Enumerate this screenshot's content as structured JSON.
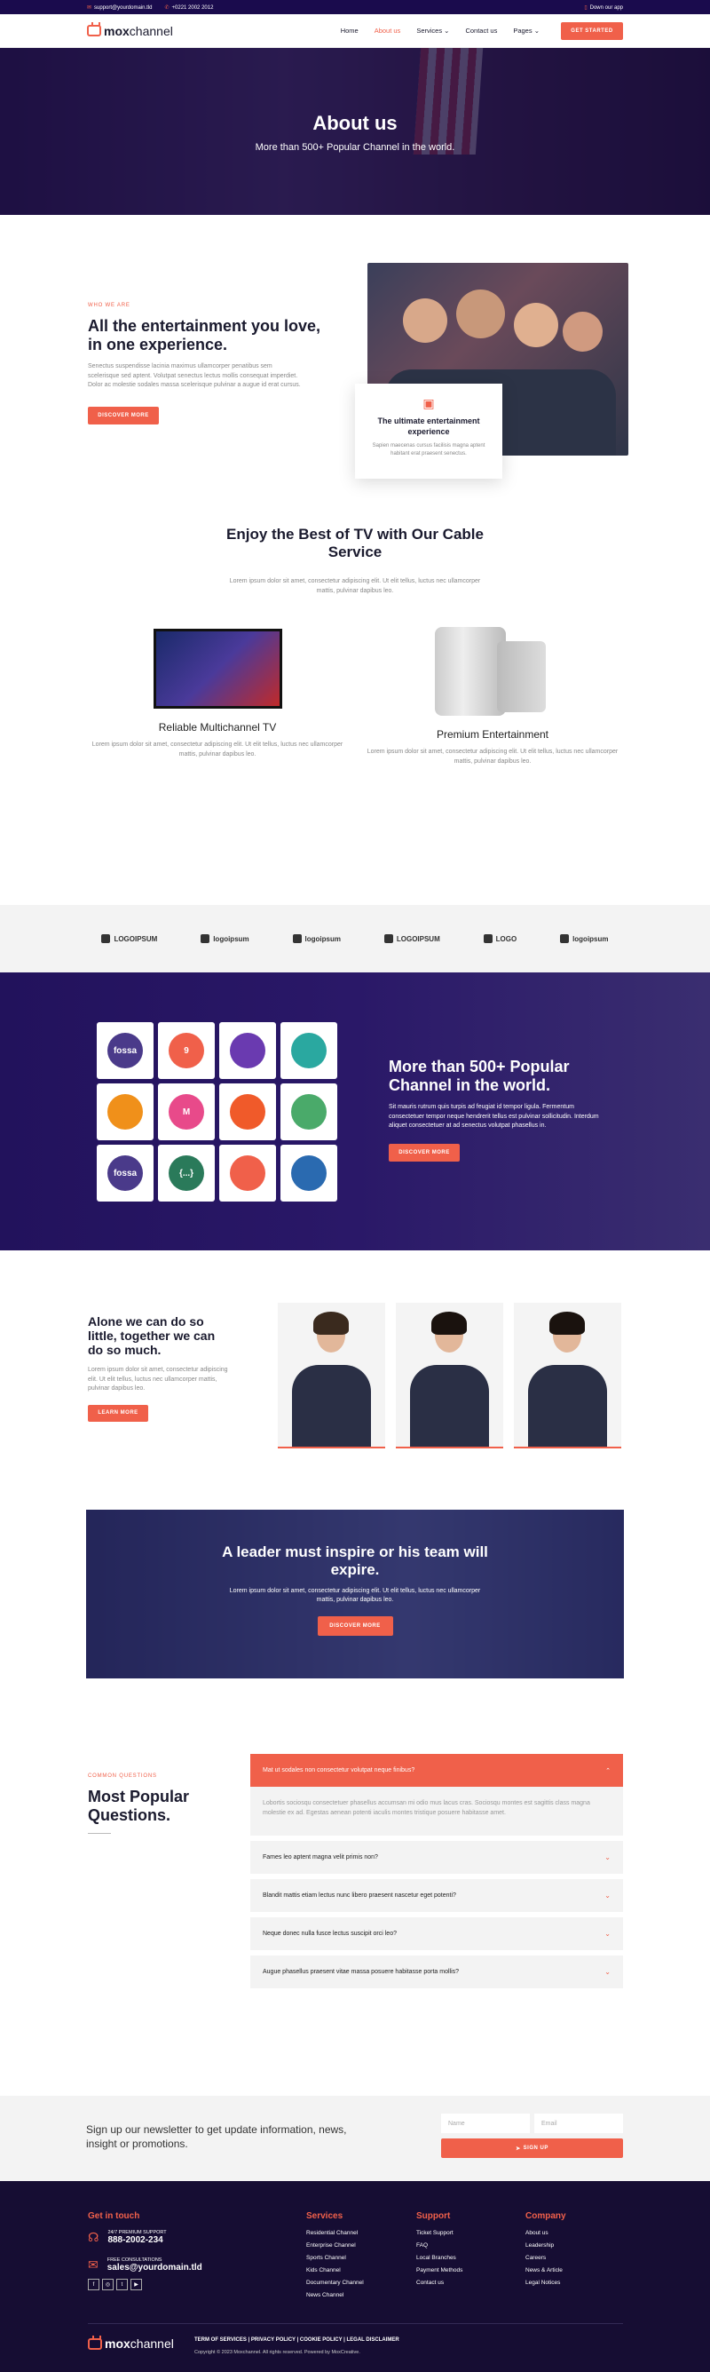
{
  "topbar": {
    "email": "support@yourdomain.tld",
    "phone": "+0221 2002 2012",
    "app": "Down our app"
  },
  "nav": {
    "logo_main": "mox",
    "logo_accent": "channel",
    "items": [
      "Home",
      "About us",
      "Services",
      "Contact us",
      "Pages"
    ],
    "cta": "GET STARTED"
  },
  "hero": {
    "title": "About us",
    "subtitle": "More than 500+ Popular Channel in the world."
  },
  "about": {
    "eyebrow": "WHO WE ARE",
    "title": "All the entertainment you love, in one experience.",
    "text": "Senectus suspendisse lacinia maximus ullamcorper penatibus sem scelerisque sed aptent. Volutpat senectus lectus mollis consequat imperdiet. Dolor ac molestie sodales massa scelerisque pulvinar a augue id erat cursus.",
    "button": "DISCOVER MORE",
    "card_title": "The ultimate entertainment experience",
    "card_text": "Sapien maecenas cursus facilisis magna aptent habitant erat praesent senectus."
  },
  "best": {
    "title": "Enjoy the Best of TV with Our Cable Service",
    "text": "Lorem ipsum dolor sit amet, consectetur adipiscing elit. Ut elit tellus, luctus nec ullamcorper mattis, pulvinar dapibus leo.",
    "features": [
      {
        "title": "Reliable Multichannel TV",
        "text": "Lorem ipsum dolor sit amet, consectetur adipiscing elit. Ut elit tellus, luctus nec ullamcorper mattis, pulvinar dapibus leo."
      },
      {
        "title": "Premium Entertainment",
        "text": "Lorem ipsum dolor sit amet, consectetur adipiscing elit. Ut elit tellus, luctus nec ullamcorper mattis, pulvinar dapibus leo."
      }
    ]
  },
  "logos": [
    "LOGOIPSUM",
    "logoipsum",
    "logoipsum",
    "LOGOIPSUM",
    "LOGO",
    "logoipsum"
  ],
  "channels": {
    "title": "More than 500+ Popular Channel in the world.",
    "text": "Sit mauris rutrum quis turpis ad feugiat id tempor ligula. Fermentum consectetuer tempor neque hendrerit tellus est pulvinar sollicitudin. Interdum aliquet consectetuer at ad senectus volutpat phasellus in.",
    "button": "DISCOVER MORE",
    "tile_labels": [
      "fossa",
      "9",
      "",
      "",
      "",
      "M",
      "",
      "",
      "fossa",
      "{...}",
      "",
      ""
    ],
    "tile_colors": [
      "#4a3a8a",
      "#f0604a",
      "#6a3ab0",
      "#2aa8a0",
      "#f0901a",
      "#e84a8a",
      "#f05a2a",
      "#4aaa6a",
      "#4a3a8a",
      "#2a7a5a",
      "#f0604a",
      "#2a6ab0"
    ]
  },
  "team": {
    "title": "Alone we can do so little, together we can do so much.",
    "text": "Lorem ipsum dolor sit amet, consectetur adipiscing elit. Ut elit tellus, luctus nec ullamcorper mattis, pulvinar dapibus leo.",
    "button": "LEARN MORE"
  },
  "leader": {
    "title": "A leader must inspire or his team will expire.",
    "text": "Lorem ipsum dolor sit amet, consectetur adipiscing elit. Ut elit tellus, luctus nec ullamcorper mattis, pulvinar dapibus leo.",
    "button": "DISCOVER MORE"
  },
  "faq": {
    "eyebrow": "COMMON QUESTIONS",
    "title": "Most Popular Questions.",
    "open_q": "Mat ut sodales non consectetur volutpat neque finibus?",
    "open_a": "Lobortis sociosqu consectetuer phasellus accumsan mi odio mus lacus cras. Sociosqu montes est sagittis class magna molestie ex ad. Egestas aenean potenti iaculis montes tristique posuere habitasse amet.",
    "items": [
      "Fames leo aptent magna velit primis non?",
      "Blandit mattis etiam lectus nunc libero praesent nascetur eget potenti?",
      "Neque donec nulla fusce lectus suscipit orci leo?",
      "Augue phasellus praesent vitae massa posuere habitasse porta mollis?"
    ]
  },
  "newsletter": {
    "text": "Sign up our newsletter to get update information, news, insight or promotions.",
    "name_ph": "Name",
    "email_ph": "Email",
    "button": "SIGN UP"
  },
  "footer": {
    "touch": "Get in touch",
    "support_label": "24/7 PREMIUM SUPPORT",
    "support_phone": "888-2002-234",
    "consult_label": "FREE CONSULTATIONS",
    "consult_email": "sales@yourdomain.tld",
    "cols": [
      {
        "title": "Services",
        "links": [
          "Residential Channel",
          "Enterprise Channel",
          "Sports Channel",
          "Kids Channel",
          "Documentary Channel",
          "News Channel"
        ]
      },
      {
        "title": "Support",
        "links": [
          "Ticket Support",
          "FAQ",
          "Local Branches",
          "Payment Methods",
          "Contact us"
        ]
      },
      {
        "title": "Company",
        "links": [
          "About us",
          "Leadership",
          "Careers",
          "News & Article",
          "Legal Notices"
        ]
      }
    ],
    "legal": "TERM OF SERVICES | PRIVACY POLICY | COOKIE POLICY | LEGAL DISCLAIMER",
    "copyright": "Copyright © 2023 Moxchannel. All rights reserved. Powered by MoxCreative."
  },
  "colors": {
    "accent": "#f0604a",
    "navy": "#1a0b4d"
  }
}
